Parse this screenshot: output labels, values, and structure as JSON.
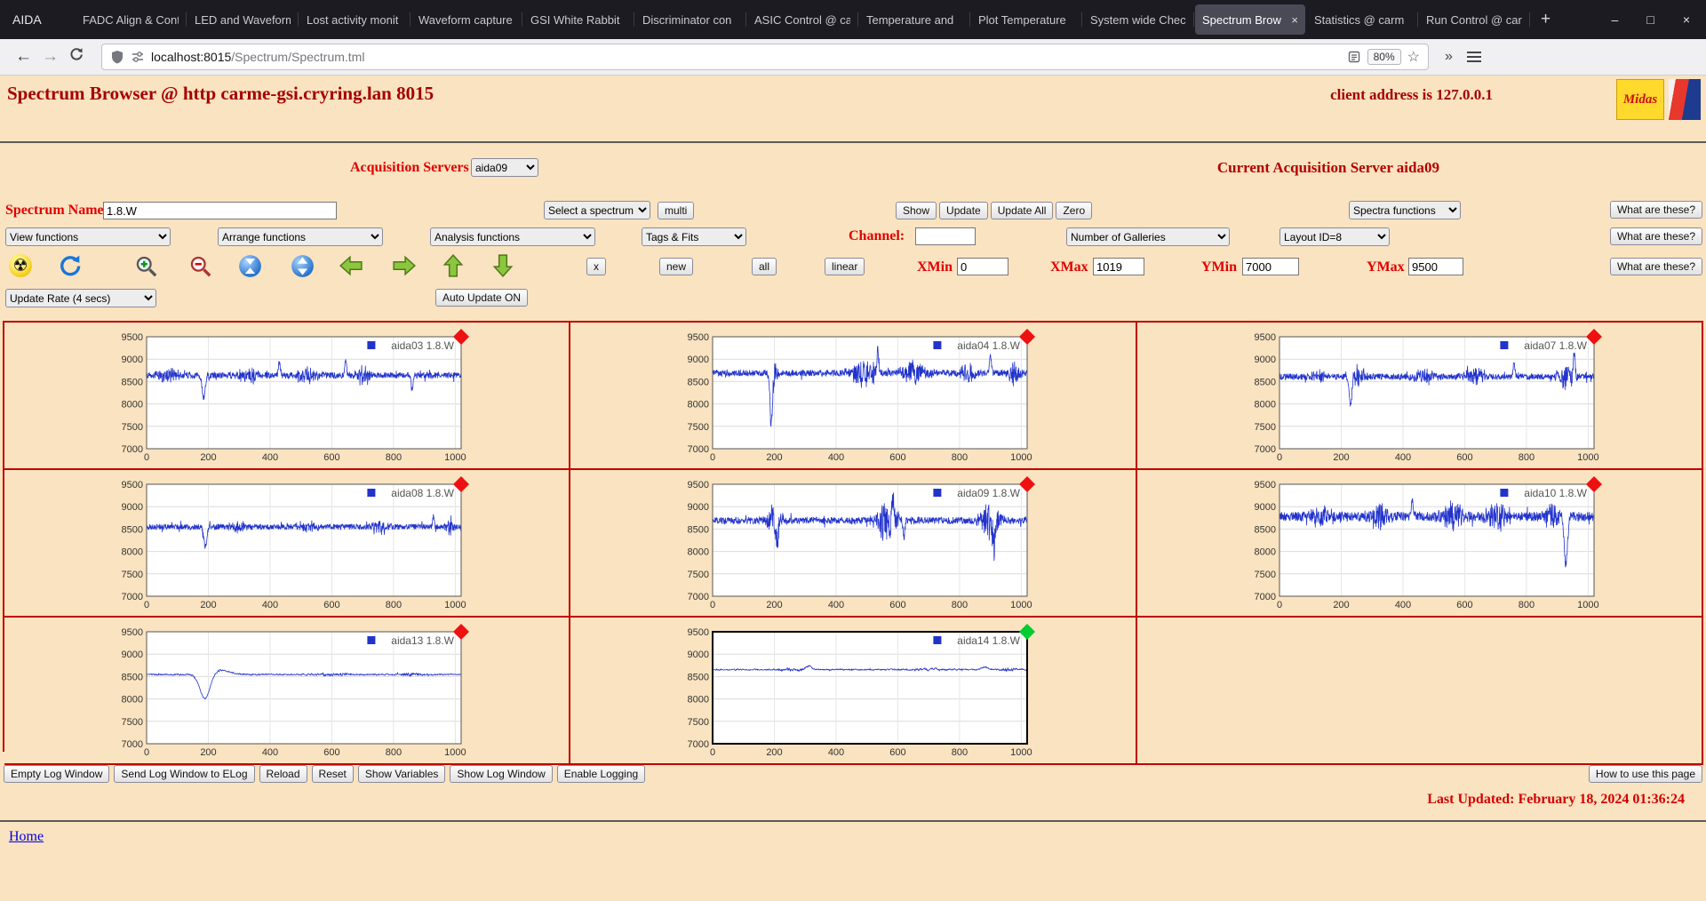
{
  "colors": {
    "page_bg": "#FAE3C0",
    "accent_red": "#E00000",
    "maroon": "#A50000",
    "grid_border": "#C00000",
    "marker_red": "#EE1111",
    "marker_green": "#00CC33"
  },
  "titlebar": {
    "app_label": "AIDA",
    "tabs": [
      {
        "label": "FADC Align & Cont",
        "active": false
      },
      {
        "label": "LED and Waveform",
        "active": false
      },
      {
        "label": "Lost activity monit",
        "active": false
      },
      {
        "label": "Waveform capture",
        "active": false
      },
      {
        "label": "GSI White Rabbit",
        "active": false
      },
      {
        "label": "Discriminator con",
        "active": false
      },
      {
        "label": "ASIC Control @ ca",
        "active": false
      },
      {
        "label": "Temperature and",
        "active": false
      },
      {
        "label": "Plot Temperature",
        "active": false
      },
      {
        "label": "System wide Chec",
        "active": false
      },
      {
        "label": "Spectrum Brow",
        "active": true
      },
      {
        "label": "Statistics @ carm",
        "active": false
      },
      {
        "label": "Run Control @ car",
        "active": false
      }
    ],
    "new_tab": "+",
    "window_controls": {
      "minimize": "–",
      "maximize": "□",
      "close": "×"
    }
  },
  "navbar": {
    "url_host": "localhost:8015",
    "url_path": "/Spectrum/Spectrum.tml",
    "zoom": "80%"
  },
  "header": {
    "title": "Spectrum Browser @ http carme-gsi.cryring.lan 8015",
    "client": "client address is 127.0.0.1",
    "midas_logo_text": "Midas"
  },
  "acquisition": {
    "label": "Acquisition Servers",
    "selected": "aida09",
    "current": "Current Acquisition Server aida09"
  },
  "controls": {
    "spectrum_name_label": "Spectrum Name:",
    "spectrum_name_value": "1.8.W",
    "select_spectrum": "Select a spectrum",
    "multi": "multi",
    "show": "Show",
    "update": "Update",
    "update_all": "Update All",
    "zero": "Zero",
    "spectra_functions": "Spectra functions",
    "what_are_these": "What are these?",
    "view_functions": "View functions",
    "arrange_functions": "Arrange functions",
    "analysis_functions": "Analysis functions",
    "tags_fits": "Tags & Fits",
    "channel_label": "Channel:",
    "channel_value": "",
    "number_of_galleries": "Number of Galleries",
    "layout_id": "Layout ID=8",
    "x_button": "x",
    "new_button": "new",
    "all_button": "all",
    "linear_button": "linear",
    "xmin_label": "XMin",
    "xmin": "0",
    "xmax_label": "XMax",
    "xmax": "1019",
    "ymin_label": "YMin",
    "ymin": "7000",
    "ymax_label": "YMax",
    "ymax": "9500",
    "update_rate": "Update Rate (4 secs)",
    "auto_update": "Auto Update ON"
  },
  "footer": {
    "buttons": [
      "Empty Log Window",
      "Send Log Window to ELog",
      "Reload",
      "Reset",
      "Show Variables",
      "Show Log Window",
      "Enable Logging"
    ],
    "help_button": "How to use this page",
    "last_updated": "Last Updated: February 18, 2024 01:36:24",
    "home": "Home"
  },
  "chart_data": {
    "type": "line",
    "grid": {
      "rows": 3,
      "cols": 3
    },
    "xlim": [
      0,
      1019
    ],
    "ylim": [
      7000,
      9500
    ],
    "xticks": [
      0,
      200,
      400,
      600,
      800,
      1000
    ],
    "yticks": [
      7000,
      7500,
      8000,
      8500,
      9000,
      9500
    ],
    "line_color": "#2233cc",
    "charts": [
      {
        "legend": "aida03 1.8.W",
        "marker": "red",
        "selected": false,
        "series": {
          "seed": 103,
          "baseline": 8640,
          "noise": 70,
          "smooth": false,
          "events": [
            {
              "type": "burst",
              "c": 70,
              "w": 25,
              "amp": 160
            },
            {
              "type": "gauss",
              "c": 185,
              "w": 5,
              "amp": -500
            },
            {
              "type": "burst",
              "c": 330,
              "w": 22,
              "amp": 190
            },
            {
              "type": "gauss",
              "c": 430,
              "w": 3,
              "amp": 300
            },
            {
              "type": "burst",
              "c": 520,
              "w": 25,
              "amp": 170
            },
            {
              "type": "gauss",
              "c": 645,
              "w": 3,
              "amp": 330
            },
            {
              "type": "burst",
              "c": 700,
              "w": 18,
              "amp": 200
            },
            {
              "type": "gauss",
              "c": 860,
              "w": 3,
              "amp": -350
            }
          ]
        }
      },
      {
        "legend": "aida04 1.8.W",
        "marker": "red",
        "selected": false,
        "series": {
          "seed": 104,
          "baseline": 8690,
          "noise": 72,
          "smooth": false,
          "events": [
            {
              "type": "gauss",
              "c": 190,
              "w": 4,
              "amp": -1150
            },
            {
              "type": "burst",
              "c": 200,
              "w": 12,
              "amp": 220
            },
            {
              "type": "burst",
              "c": 490,
              "w": 35,
              "amp": 280
            },
            {
              "type": "gauss",
              "c": 535,
              "w": 3,
              "amp": 470
            },
            {
              "type": "burst",
              "c": 650,
              "w": 30,
              "amp": 260
            },
            {
              "type": "burst",
              "c": 830,
              "w": 18,
              "amp": 230
            },
            {
              "type": "gauss",
              "c": 900,
              "w": 3,
              "amp": 380
            },
            {
              "type": "burst",
              "c": 975,
              "w": 14,
              "amp": 280
            }
          ]
        }
      },
      {
        "legend": "aida07 1.8.W",
        "marker": "red",
        "selected": false,
        "series": {
          "seed": 107,
          "baseline": 8610,
          "noise": 68,
          "smooth": false,
          "events": [
            {
              "type": "burst",
              "c": 120,
              "w": 20,
              "amp": 150
            },
            {
              "type": "gauss",
              "c": 230,
              "w": 4,
              "amp": -650
            },
            {
              "type": "burst",
              "c": 255,
              "w": 15,
              "amp": 260
            },
            {
              "type": "burst",
              "c": 470,
              "w": 25,
              "amp": 160
            },
            {
              "type": "burst",
              "c": 630,
              "w": 22,
              "amp": 200
            },
            {
              "type": "gauss",
              "c": 760,
              "w": 3,
              "amp": 320
            },
            {
              "type": "burst",
              "c": 930,
              "w": 22,
              "amp": 260
            },
            {
              "type": "gauss",
              "c": 955,
              "w": 3,
              "amp": 480
            }
          ]
        }
      },
      {
        "legend": "aida08 1.8.W",
        "marker": "red",
        "selected": false,
        "series": {
          "seed": 108,
          "baseline": 8550,
          "noise": 62,
          "smooth": false,
          "events": [
            {
              "type": "gauss",
              "c": 190,
              "w": 5,
              "amp": -430
            },
            {
              "type": "burst",
              "c": 300,
              "w": 25,
              "amp": 110
            },
            {
              "type": "burst",
              "c": 520,
              "w": 25,
              "amp": 120
            },
            {
              "type": "burst",
              "c": 760,
              "w": 22,
              "amp": 130
            },
            {
              "type": "gauss",
              "c": 930,
              "w": 3,
              "amp": 250
            },
            {
              "type": "burst",
              "c": 985,
              "w": 10,
              "amp": 170
            }
          ]
        }
      },
      {
        "legend": "aida09 1.8.W",
        "marker": "red",
        "selected": false,
        "series": {
          "seed": 109,
          "baseline": 8690,
          "noise": 78,
          "smooth": false,
          "events": [
            {
              "type": "burst",
              "c": 200,
              "w": 15,
              "amp": 380
            },
            {
              "type": "gauss",
              "c": 208,
              "w": 4,
              "amp": -450
            },
            {
              "type": "burst",
              "c": 565,
              "w": 25,
              "amp": 440
            },
            {
              "type": "gauss",
              "c": 585,
              "w": 3,
              "amp": 560
            },
            {
              "type": "gauss",
              "c": 620,
              "w": 3,
              "amp": -380
            },
            {
              "type": "burst",
              "c": 900,
              "w": 22,
              "amp": 430
            },
            {
              "type": "gauss",
              "c": 912,
              "w": 4,
              "amp": -620
            }
          ]
        }
      },
      {
        "legend": "aida10 1.8.W",
        "marker": "red",
        "selected": false,
        "series": {
          "seed": 110,
          "baseline": 8780,
          "noise": 105,
          "smooth": false,
          "events": [
            {
              "type": "burst",
              "c": 140,
              "w": 25,
              "amp": 260
            },
            {
              "type": "burst",
              "c": 320,
              "w": 22,
              "amp": 280
            },
            {
              "type": "gauss",
              "c": 430,
              "w": 3,
              "amp": 380
            },
            {
              "type": "burst",
              "c": 560,
              "w": 28,
              "amp": 300
            },
            {
              "type": "burst",
              "c": 705,
              "w": 22,
              "amp": 280
            },
            {
              "type": "burst",
              "c": 880,
              "w": 18,
              "amp": 330
            },
            {
              "type": "gauss",
              "c": 928,
              "w": 5,
              "amp": -1080
            }
          ]
        }
      },
      {
        "legend": "aida13 1.8.W",
        "marker": "red",
        "selected": false,
        "series": {
          "seed": 113,
          "baseline": 8545,
          "noise": 26,
          "smooth": true,
          "events": [
            {
              "type": "gauss",
              "c": 188,
              "w": 16,
              "amp": -560
            },
            {
              "type": "gauss",
              "c": 240,
              "w": 30,
              "amp": 90
            },
            {
              "type": "burst",
              "c": 600,
              "w": 50,
              "amp": 55
            },
            {
              "type": "burst",
              "c": 860,
              "w": 35,
              "amp": 55
            }
          ]
        }
      },
      {
        "legend": "aida14 1.8.W",
        "marker": "green",
        "selected": true,
        "series": {
          "seed": 114,
          "baseline": 8655,
          "noise": 24,
          "smooth": true,
          "events": [
            {
              "type": "burst",
              "c": 260,
              "w": 35,
              "amp": 55
            },
            {
              "type": "gauss",
              "c": 310,
              "w": 8,
              "amp": 85
            },
            {
              "type": "burst",
              "c": 700,
              "w": 45,
              "amp": 45
            },
            {
              "type": "gauss",
              "c": 880,
              "w": 10,
              "amp": 60
            },
            {
              "type": "burst",
              "c": 955,
              "w": 25,
              "amp": 60
            }
          ]
        }
      }
    ]
  }
}
